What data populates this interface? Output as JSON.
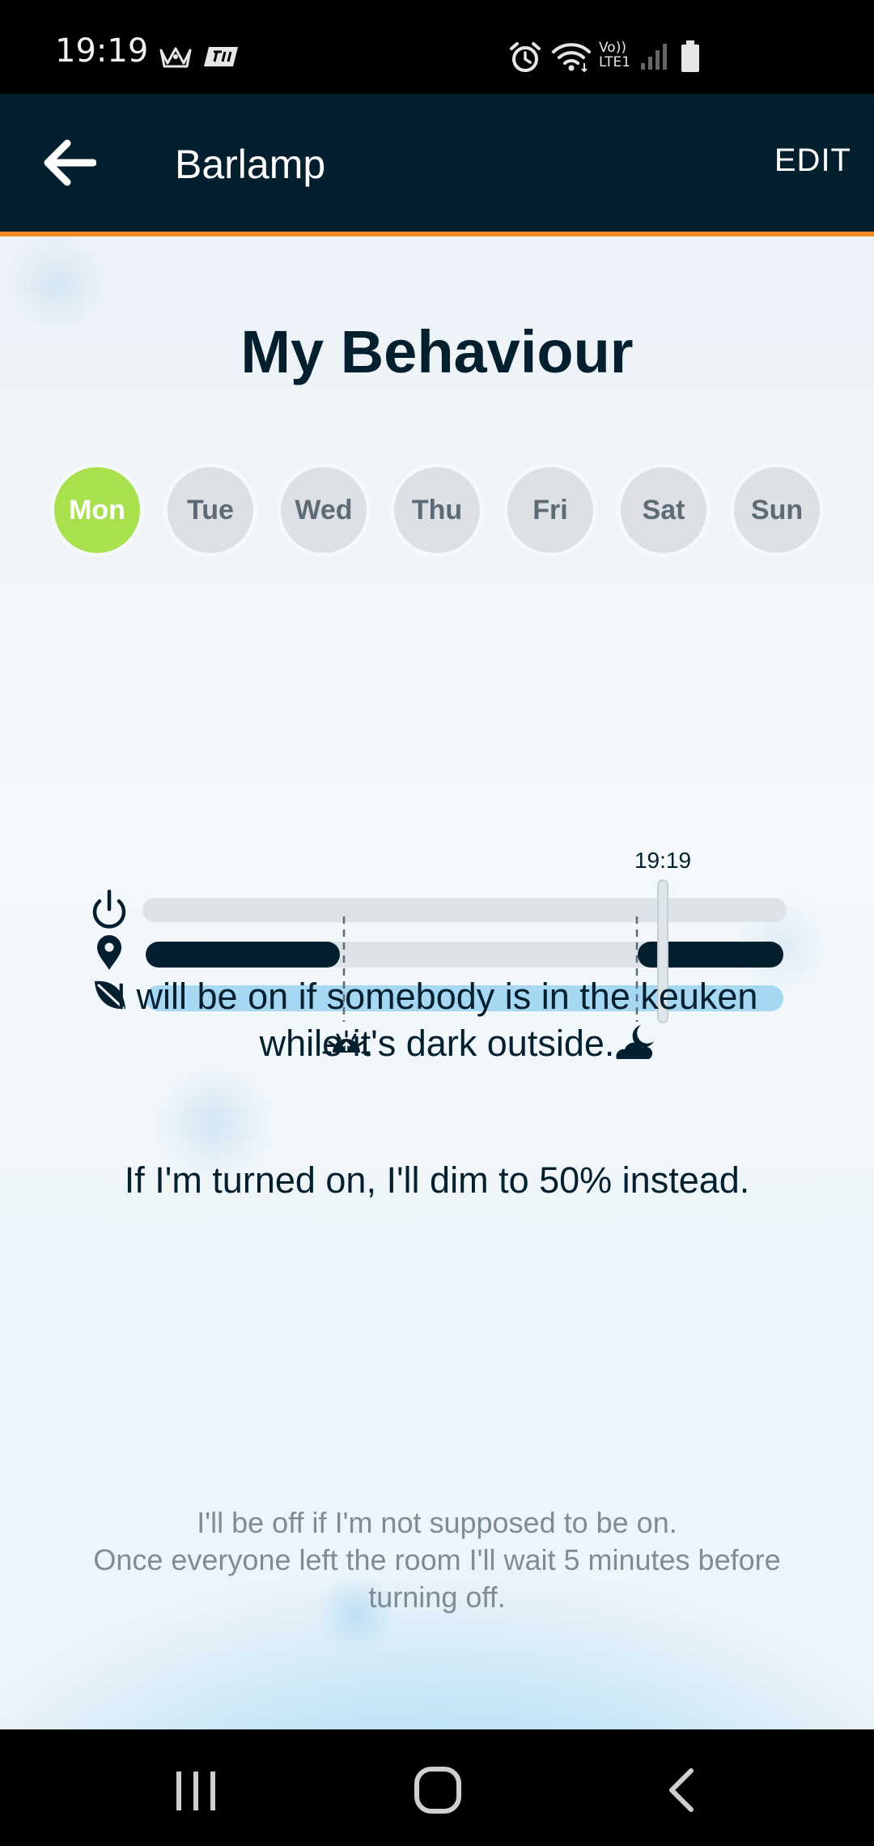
{
  "status_bar": {
    "time": "19:19",
    "icons": [
      "crown-icon",
      "app-icon",
      "alarm-icon",
      "wifi-icon",
      "volte-icon",
      "signal-icon",
      "battery-icon"
    ],
    "volte_line1": "Vo))",
    "volte_line2": "LTE1"
  },
  "app_bar": {
    "title": "Barlamp",
    "edit_label": "EDIT",
    "background_color": "#04202f",
    "accent_color": "#f08a24"
  },
  "main": {
    "title": "My Behaviour",
    "days": [
      {
        "label": "Mon",
        "active": true
      },
      {
        "label": "Tue",
        "active": false
      },
      {
        "label": "Wed",
        "active": false
      },
      {
        "label": "Thu",
        "active": false
      },
      {
        "label": "Fri",
        "active": false
      },
      {
        "label": "Sat",
        "active": false
      },
      {
        "label": "Sun",
        "active": false
      }
    ],
    "active_day_color": "#a8e04e",
    "timeline": {
      "current_time": "19:19",
      "rows": [
        "power-icon",
        "location-pin-icon",
        "leaf-icon"
      ],
      "markers": [
        "sunrise-icon",
        "moon-night-icon"
      ]
    },
    "description_1_line1": "I will be on if somebody is in the keuken",
    "description_1_line2": "while it's dark outside.",
    "description_2": "If I'm turned on, I'll dim to 50% instead.",
    "footnote_line1": "I'll be off if I'm not supposed to be on.",
    "footnote_line2": "Once everyone left the room I'll wait 5 minutes before",
    "footnote_line3": "turning off."
  },
  "nav_bar": {
    "icons": [
      "recent-apps-icon",
      "home-icon",
      "back-nav-icon"
    ]
  }
}
